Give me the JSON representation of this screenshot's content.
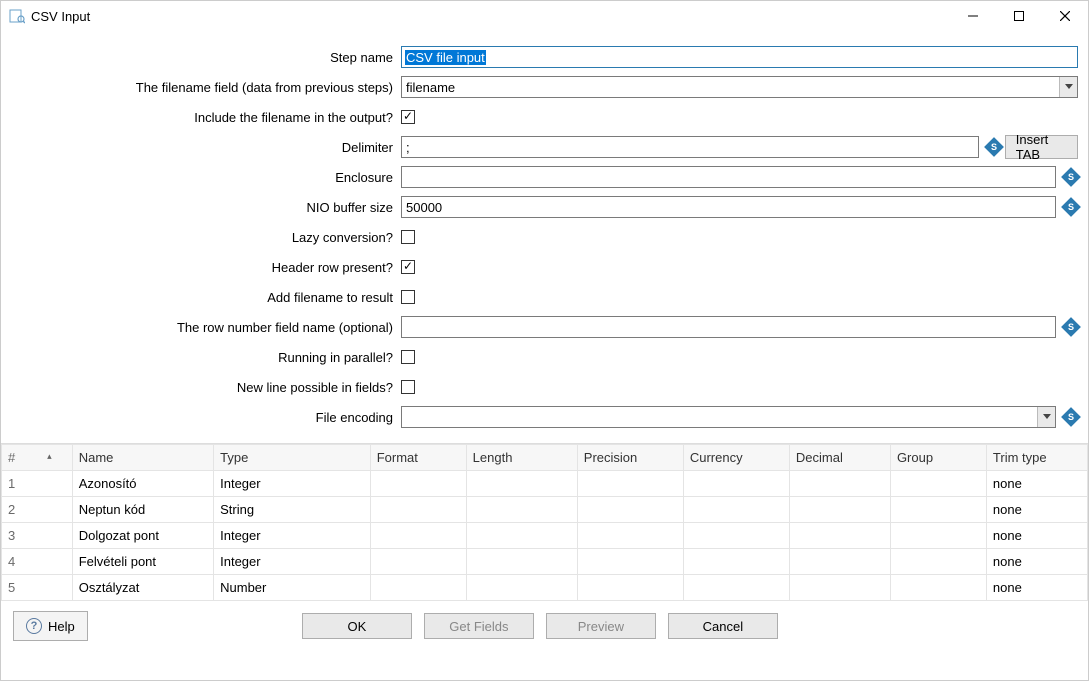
{
  "window": {
    "title": "CSV Input"
  },
  "form": {
    "step_name_label": "Step name",
    "step_name_value": "CSV file input",
    "filename_field_label": "The filename field (data from previous steps)",
    "filename_field_value": "filename",
    "include_filename_label": "Include the filename in the output?",
    "include_filename_checked": true,
    "delimiter_label": "Delimiter",
    "delimiter_value": ";",
    "insert_tab_label": "Insert TAB",
    "enclosure_label": "Enclosure",
    "enclosure_value": "",
    "nio_label": "NIO buffer size",
    "nio_value": "50000",
    "lazy_label": "Lazy conversion?",
    "lazy_checked": false,
    "header_label": "Header row present?",
    "header_checked": true,
    "addfn_label": "Add filename to result",
    "addfn_checked": false,
    "rownum_label": "The row number field name (optional)",
    "rownum_value": "",
    "parallel_label": "Running in parallel?",
    "parallel_checked": false,
    "newline_label": "New line possible in fields?",
    "newline_checked": false,
    "encoding_label": "File encoding",
    "encoding_value": ""
  },
  "diamond_glyph": "S",
  "table": {
    "headers": {
      "row": "#",
      "name": "Name",
      "type": "Type",
      "format": "Format",
      "length": "Length",
      "precision": "Precision",
      "currency": "Currency",
      "decimal": "Decimal",
      "group": "Group",
      "trim": "Trim type"
    },
    "rows": [
      {
        "n": "1",
        "name": "Azonosító",
        "type": "Integer",
        "format": "",
        "length": "",
        "precision": "",
        "currency": "",
        "decimal": "",
        "group": "",
        "trim": "none"
      },
      {
        "n": "2",
        "name": "Neptun kód",
        "type": "String",
        "format": "",
        "length": "",
        "precision": "",
        "currency": "",
        "decimal": "",
        "group": "",
        "trim": "none"
      },
      {
        "n": "3",
        "name": "Dolgozat pont",
        "type": "Integer",
        "format": "",
        "length": "",
        "precision": "",
        "currency": "",
        "decimal": "",
        "group": "",
        "trim": "none"
      },
      {
        "n": "4",
        "name": "Felvételi pont",
        "type": "Integer",
        "format": "",
        "length": "",
        "precision": "",
        "currency": "",
        "decimal": "",
        "group": "",
        "trim": "none"
      },
      {
        "n": "5",
        "name": "Osztályzat",
        "type": "Number",
        "format": "",
        "length": "",
        "precision": "",
        "currency": "",
        "decimal": "",
        "group": "",
        "trim": "none"
      }
    ]
  },
  "buttons": {
    "help": "Help",
    "ok": "OK",
    "get_fields": "Get Fields",
    "preview": "Preview",
    "cancel": "Cancel"
  }
}
